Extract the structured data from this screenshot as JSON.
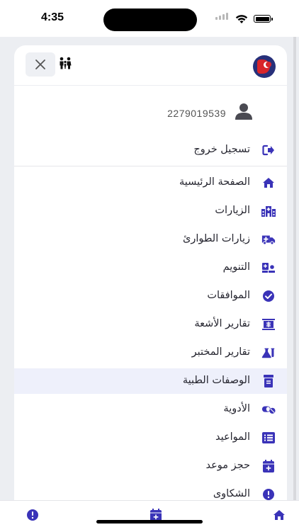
{
  "status_bar": {
    "time": "4:35"
  },
  "drawer": {
    "user_id": "2279019539",
    "logout_label": "تسجيل خروج",
    "items": [
      {
        "label": "الصفحة الرئيسية",
        "icon": "home-icon"
      },
      {
        "label": "الزيارات",
        "icon": "hospital-icon"
      },
      {
        "label": "زيارات الطوارئ",
        "icon": "ambulance-icon"
      },
      {
        "label": "التنويم",
        "icon": "hospital-bed-icon"
      },
      {
        "label": "الموافقات",
        "icon": "check-circle-icon"
      },
      {
        "label": "تقارير الأشعة",
        "icon": "xray-icon"
      },
      {
        "label": "تقارير المختبر",
        "icon": "flask-icon"
      },
      {
        "label": "الوصفات الطبية",
        "icon": "prescription-icon",
        "active": true
      },
      {
        "label": "الأدوية",
        "icon": "pills-icon"
      },
      {
        "label": "المواعيد",
        "icon": "list-icon"
      },
      {
        "label": "حجز موعد",
        "icon": "calendar-plus-icon"
      },
      {
        "label": "الشكاوى",
        "icon": "exclamation-circle-icon"
      }
    ]
  },
  "tabbar": {
    "tabs": [
      "complaints-tab",
      "booking-tab",
      "home-tab"
    ]
  },
  "colors": {
    "accent": "#3a33b8",
    "active_bg": "#eef0fb"
  }
}
